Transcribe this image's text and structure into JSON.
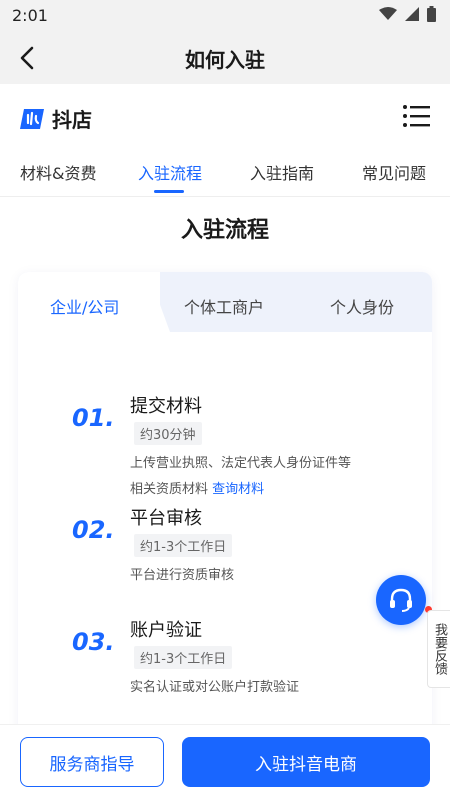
{
  "status_bar": {
    "time": "2:01"
  },
  "app_bar": {
    "title": "如何入驻"
  },
  "brand": {
    "name": "抖店"
  },
  "tabs": [
    {
      "label": "材料&资费"
    },
    {
      "label": "入驻流程"
    },
    {
      "label": "入驻指南"
    },
    {
      "label": "常见问题"
    }
  ],
  "section_title": "入驻流程",
  "subtabs": [
    {
      "label": "企业/公司"
    },
    {
      "label": "个体工商户"
    },
    {
      "label": "个人身份"
    }
  ],
  "steps": [
    {
      "num": "01.",
      "title": "提交材料",
      "badge": "约30分钟",
      "desc1": "上传营业执照、法定代表人身份证件等",
      "desc2": "相关资质材料",
      "link": "查询材料"
    },
    {
      "num": "02.",
      "title": "平台审核",
      "badge": "约1-3个工作日",
      "desc1": "平台进行资质审核"
    },
    {
      "num": "03.",
      "title": "账户验证",
      "badge": "约1-3个工作日",
      "desc1": "实名认证或对公账户打款验证"
    }
  ],
  "feedback": {
    "label": "我要反馈"
  },
  "bottom": {
    "secondary_label": "服务商指导",
    "primary_label": "入驻抖音电商"
  },
  "colors": {
    "accent": "#1966ff"
  }
}
